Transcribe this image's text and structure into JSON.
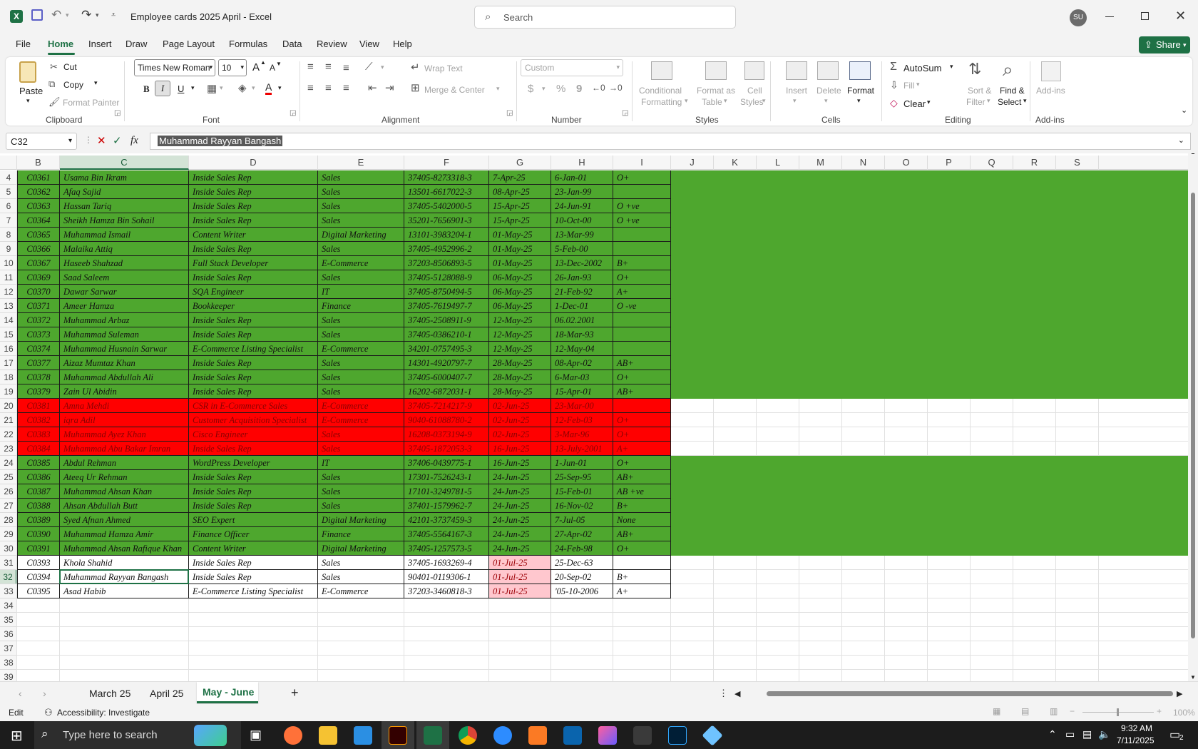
{
  "titlebar": {
    "filename": "Employee cards 2025 April",
    "sep": " - ",
    "app": "Excel",
    "search_placeholder": "Search",
    "avatar": "SU"
  },
  "menu": {
    "items": [
      "File",
      "Home",
      "Insert",
      "Draw",
      "Page Layout",
      "Formulas",
      "Data",
      "Review",
      "View",
      "Help"
    ],
    "active": "Home",
    "share": "Share"
  },
  "ribbon": {
    "clipboard": {
      "paste": "Paste",
      "cut": "Cut",
      "copy": "Copy",
      "format_painter": "Format Painter",
      "group": "Clipboard"
    },
    "font": {
      "name": "Times New Roman",
      "size": "10",
      "bold": "B",
      "italic": "I",
      "underline": "U",
      "font_color": "A",
      "grow": "A",
      "shrink": "A",
      "group": "Font"
    },
    "alignment": {
      "wrap": "Wrap Text",
      "merge": "Merge & Center",
      "group": "Alignment"
    },
    "number": {
      "format": "Custom",
      "currency": "$",
      "percent": "%",
      "comma": "9",
      "group": "Number"
    },
    "styles": {
      "conditional": "Conditional",
      "conditional2": "Formatting",
      "format_table": "Format as",
      "format_table2": "Table",
      "cell_styles": "Cell",
      "cell_styles2": "Styles",
      "group": "Styles"
    },
    "cells": {
      "insert": "Insert",
      "delete": "Delete",
      "format": "Format",
      "group": "Cells"
    },
    "editing": {
      "autosum": "AutoSum",
      "fill": "Fill",
      "clear": "Clear",
      "sort": "Sort &",
      "sort2": "Filter",
      "find": "Find &",
      "find2": "Select",
      "group": "Editing"
    },
    "addins": {
      "label": "Add-ins",
      "group": "Add-ins"
    }
  },
  "formula": {
    "name_box": "C32",
    "fx": "fx",
    "content": "Muhammad Rayyan Bangash"
  },
  "columns": [
    "B",
    "C",
    "D",
    "E",
    "F",
    "G",
    "H",
    "I",
    "J",
    "K",
    "L",
    "M",
    "N",
    "O",
    "P",
    "Q",
    "R",
    "S"
  ],
  "rows": [
    {
      "n": "4",
      "id": "C0361",
      "name": "Usama Bin Ikram",
      "role": "Inside Sales Rep",
      "dept": "Sales",
      "cnic": "37405-8273318-3",
      "join": "7-Apr-25",
      "dob": "6-Jan-01",
      "blood": "O+",
      "fill": "green"
    },
    {
      "n": "5",
      "id": "C0362",
      "name": "Afaq Sajid",
      "role": "Inside Sales Rep",
      "dept": "Sales",
      "cnic": "13501-6617022-3",
      "join": "08-Apr-25",
      "dob": "23-Jan-99",
      "blood": "",
      "fill": "green"
    },
    {
      "n": "6",
      "id": "C0363",
      "name": "Hassan Tariq",
      "role": "Inside Sales Rep",
      "dept": "Sales",
      "cnic": "37405-5402000-5",
      "join": "15-Apr-25",
      "dob": "24-Jun-91",
      "blood": "O +ve",
      "fill": "green"
    },
    {
      "n": "7",
      "id": "C0364",
      "name": "Sheikh Hamza Bin Sohail",
      "role": "Inside Sales Rep",
      "dept": "Sales",
      "cnic": "35201-7656901-3",
      "join": "15-Apr-25",
      "dob": "10-Oct-00",
      "blood": "O +ve",
      "fill": "green"
    },
    {
      "n": "8",
      "id": "C0365",
      "name": "Muhammad Ismail",
      "role": "Content Writer",
      "dept": "Digital Marketing",
      "cnic": "13101-3983204-1",
      "join": "01-May-25",
      "dob": "13-Mar-99",
      "blood": "",
      "fill": "green"
    },
    {
      "n": "9",
      "id": "C0366",
      "name": "Malaika Attiq",
      "role": "Inside Sales Rep",
      "dept": "Sales",
      "cnic": "37405-4952996-2",
      "join": "01-May-25",
      "dob": "5-Feb-00",
      "blood": "",
      "fill": "green"
    },
    {
      "n": "10",
      "id": "C0367",
      "name": "Haseeb Shahzad",
      "role": "Full Stack Developer",
      "dept": "E-Commerce",
      "cnic": "37203-8506893-5",
      "join": "01-May-25",
      "dob": "13-Dec-2002",
      "blood": "B+",
      "fill": "green"
    },
    {
      "n": "11",
      "id": "C0369",
      "name": "Saad Saleem",
      "role": "Inside Sales Rep",
      "dept": "Sales",
      "cnic": "37405-5128088-9",
      "join": "06-May-25",
      "dob": "26-Jan-93",
      "blood": "O+",
      "fill": "green"
    },
    {
      "n": "12",
      "id": "C0370",
      "name": "Dawar Sarwar",
      "role": "SQA Engineer",
      "dept": "IT",
      "cnic": "37405-8750494-5",
      "join": "06-May-25",
      "dob": "21-Feb-92",
      "blood": "A+",
      "fill": "green"
    },
    {
      "n": "13",
      "id": "C0371",
      "name": "Ameer Hamza",
      "role": "Bookkeeper",
      "dept": "Finance",
      "cnic": "37405-7619497-7",
      "join": "06-May-25",
      "dob": "1-Dec-01",
      "blood": "O -ve",
      "fill": "green"
    },
    {
      "n": "14",
      "id": "C0372",
      "name": "Muhammad Arbaz",
      "role": "Inside Sales Rep",
      "dept": "Sales",
      "cnic": "37405-2508911-9",
      "join": "12-May-25",
      "dob": "06.02.2001",
      "blood": "",
      "fill": "green"
    },
    {
      "n": "15",
      "id": "C0373",
      "name": "Muhammad Suleman",
      "role": "Inside Sales Rep",
      "dept": "Sales",
      "cnic": "37405-0386210-1",
      "join": "12-May-25",
      "dob": "18-Mar-93",
      "blood": "",
      "fill": "green"
    },
    {
      "n": "16",
      "id": "C0374",
      "name": "Muhammad Husnain Sarwar",
      "role": "E-Commerce Listing Specialist",
      "dept": "E-Commerce",
      "cnic": "34201-0757495-3",
      "join": "12-May-25",
      "dob": "12-May-04",
      "blood": "",
      "fill": "green"
    },
    {
      "n": "17",
      "id": "C0377",
      "name": "Aizaz Mumtaz Khan",
      "role": "Inside Sales Rep",
      "dept": "Sales",
      "cnic": "14301-4920797-7",
      "join": "28-May-25",
      "dob": "08-Apr-02",
      "blood": "AB+",
      "fill": "green"
    },
    {
      "n": "18",
      "id": "C0378",
      "name": "Muhammad Abdullah Ali",
      "role": "Inside Sales Rep",
      "dept": "Sales",
      "cnic": "37405-6000407-7",
      "join": "28-May-25",
      "dob": "6-Mar-03",
      "blood": "O+",
      "fill": "green"
    },
    {
      "n": "19",
      "id": "C0379",
      "name": "Zain Ul Abidin",
      "role": "Inside Sales Rep",
      "dept": "Sales",
      "cnic": "16202-6872031-1",
      "join": "28-May-25",
      "dob": "15-Apr-01",
      "blood": "AB+",
      "fill": "green"
    },
    {
      "n": "20",
      "id": "C0381",
      "name": "Amna Mehdi",
      "role": "CSR in E-Commerce Sales",
      "dept": "E-Commerce",
      "cnic": "37405-7214217-9",
      "join": "02-Jun-25",
      "dob": "23-Mar-00",
      "blood": "",
      "fill": "red"
    },
    {
      "n": "21",
      "id": "C0382",
      "name": "iqra Adil",
      "role": "Customer Acquisition Specialist",
      "dept": "E-Commerce",
      "cnic": "9040-61088780-2",
      "join": "02-Jun-25",
      "dob": "12-Feb-03",
      "blood": "O+",
      "fill": "red"
    },
    {
      "n": "22",
      "id": "C0383",
      "name": "Muhammad Ayez Khan",
      "role": "Cisco Engineer",
      "dept": "Sales",
      "cnic": "16208-0373194-9",
      "join": "02-Jun-25",
      "dob": "3-Mar-96",
      "blood": "O+",
      "fill": "red"
    },
    {
      "n": "23",
      "id": "C0384",
      "name": "Muhammad Abu Bakar Imran",
      "role": "Inside Sales Rep",
      "dept": "Sales",
      "cnic": "37405-1872053-3",
      "join": "16-Jun-25",
      "dob": "13-July-2001",
      "blood": "A+",
      "fill": "red"
    },
    {
      "n": "24",
      "id": "C0385",
      "name": "Abdul Rehman",
      "role": "WordPress Developer",
      "dept": "IT",
      "cnic": "37406-0439775-1",
      "join": "16-Jun-25",
      "dob": "1-Jun-01",
      "blood": "O+",
      "fill": "green"
    },
    {
      "n": "25",
      "id": "C0386",
      "name": "Ateeq Ur Rehman",
      "role": "Inside Sales Rep",
      "dept": "Sales",
      "cnic": "17301-7526243-1",
      "join": "24-Jun-25",
      "dob": "25-Sep-95",
      "blood": "AB+",
      "fill": "green"
    },
    {
      "n": "26",
      "id": "C0387",
      "name": "Muhammad Ahsan Khan",
      "role": "Inside Sales Rep",
      "dept": "Sales",
      "cnic": "17101-3249781-5",
      "join": "24-Jun-25",
      "dob": "15-Feb-01",
      "blood": "AB +ve",
      "fill": "green"
    },
    {
      "n": "27",
      "id": "C0388",
      "name": "Ahsan Abdullah Butt",
      "role": "Inside Sales Rep",
      "dept": "Sales",
      "cnic": "37401-1579962-7",
      "join": "24-Jun-25",
      "dob": "16-Nov-02",
      "blood": "B+",
      "fill": "green"
    },
    {
      "n": "28",
      "id": "C0389",
      "name": "Syed Afnan Ahmed",
      "role": "SEO Expert",
      "dept": "Digital Marketing",
      "cnic": "42101-3737459-3",
      "join": "24-Jun-25",
      "dob": "7-Jul-05",
      "blood": "None",
      "fill": "green"
    },
    {
      "n": "29",
      "id": "C0390",
      "name": "Muhammad Hamza Amir",
      "role": "Finance Officer",
      "dept": "Finance",
      "cnic": "37405-5564167-3",
      "join": "24-Jun-25",
      "dob": "27-Apr-02",
      "blood": "AB+",
      "fill": "green"
    },
    {
      "n": "30",
      "id": "C0391",
      "name": "Muhammad Ahsan Rafique Khan",
      "role": "Content Writer",
      "dept": "Digital Marketing",
      "cnic": "37405-1257573-5",
      "join": "24-Jun-25",
      "dob": "24-Feb-98",
      "blood": "O+",
      "fill": "green"
    },
    {
      "n": "31",
      "id": "C0393",
      "name": "Khola Shahid",
      "role": "Inside Sales Rep",
      "dept": "Sales",
      "cnic": "37405-1693269-4",
      "join": "01-Jul-25",
      "dob": "25-Dec-63",
      "blood": "",
      "fill": "white"
    },
    {
      "n": "32",
      "id": "C0394",
      "name": "Muhammad Rayyan Bangash",
      "role": "Inside Sales Rep",
      "dept": "Sales",
      "cnic": "90401-0119306-1",
      "join": "01-Jul-25",
      "dob": "20-Sep-02",
      "blood": "B+",
      "fill": "white"
    },
    {
      "n": "33",
      "id": "C0395",
      "name": "Asad Habib",
      "role": "E-Commerce Listing Specialist",
      "dept": "E-Commerce",
      "cnic": "37203-3460818-3",
      "join": "01-Jul-25",
      "dob": "'05-10-2006",
      "blood": "A+",
      "fill": "white"
    }
  ],
  "empty_rows": [
    "34",
    "35",
    "36",
    "37",
    "38",
    "39"
  ],
  "colors": {
    "green": "#4ea72e",
    "red": "#ff0000",
    "pink": "#ffc7ce",
    "excel_green": "#1e7145"
  },
  "sheets": {
    "tabs": [
      "March 25",
      "April 25",
      "May - June"
    ],
    "active": "May - June",
    "add": "+"
  },
  "status": {
    "mode": "Edit",
    "accessibility": "Accessibility: Investigate",
    "zoom": "100%"
  },
  "taskbar": {
    "search_placeholder": "Type here to search",
    "time": "9:32 AM",
    "date": "7/11/2025",
    "notif": "2"
  }
}
